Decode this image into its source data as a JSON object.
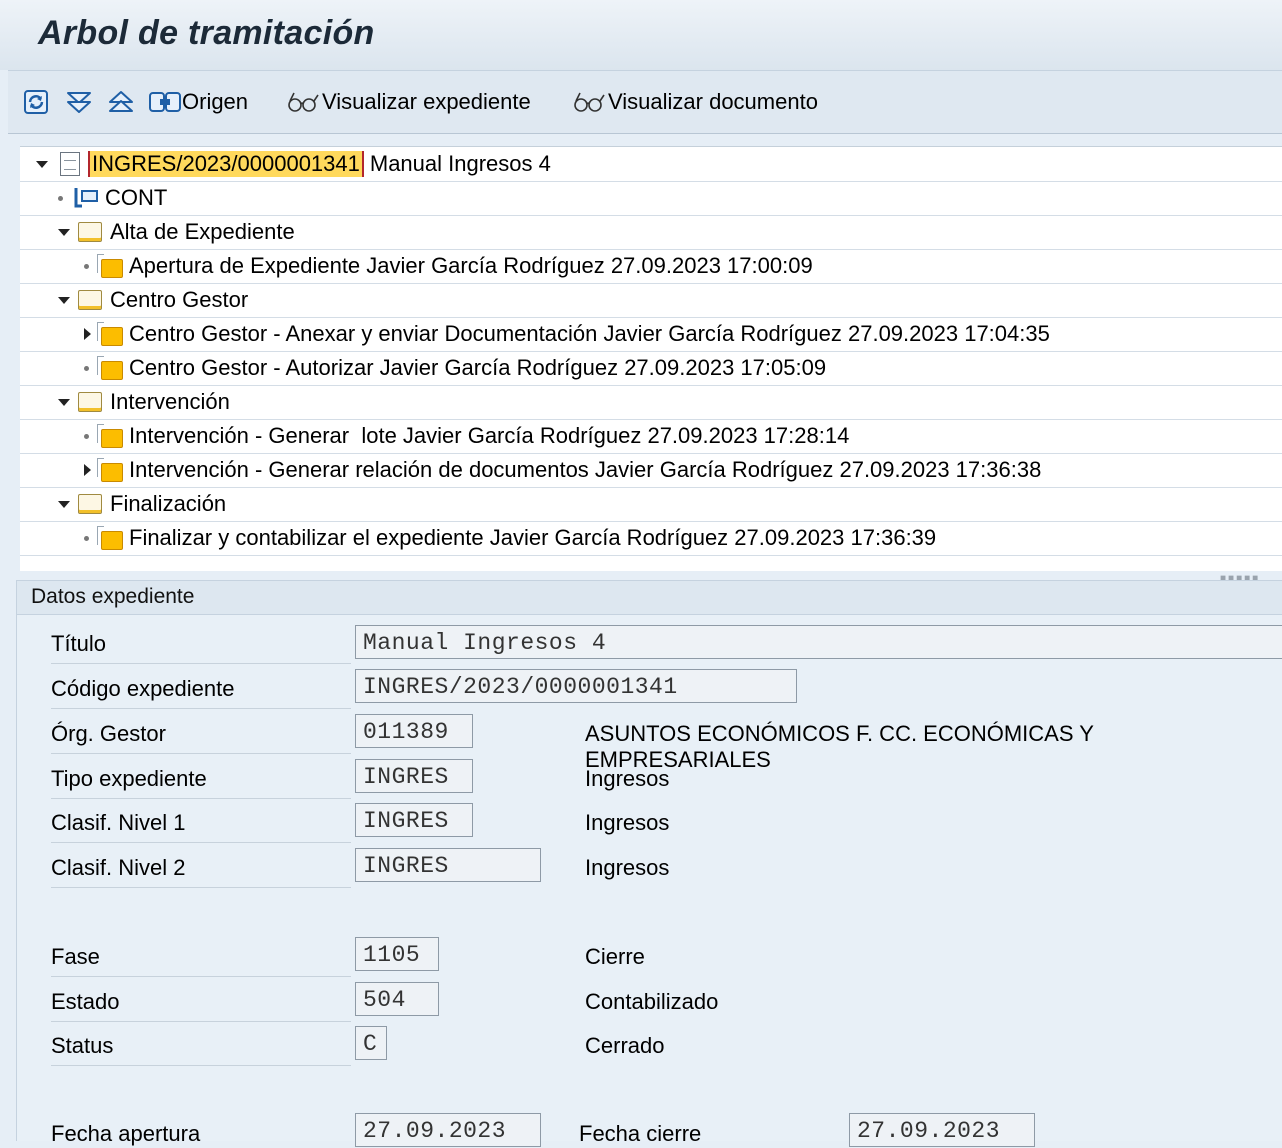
{
  "window": {
    "title": "Arbol de tramitación"
  },
  "toolbar": {
    "origin_label": "Origen",
    "view_file_label": "Visualizar expediente",
    "view_document_label": "Visualizar documento",
    "icons": [
      "refresh-icon",
      "expand-all-icon",
      "collapse-all-icon",
      "origin-icon",
      "glasses-icon",
      "glasses-icon"
    ]
  },
  "tree": {
    "root": {
      "id": "INGRES/2023/0000001341",
      "title": "Manual Ingresos 4"
    },
    "rows": [
      {
        "text": "CONT"
      },
      {
        "text": "Alta de Expediente"
      },
      {
        "text": "Apertura de Expediente Javier García Rodríguez 27.09.2023 17:00:09"
      },
      {
        "text": "Centro Gestor"
      },
      {
        "text": "Centro Gestor - Anexar y enviar Documentación Javier García Rodríguez 27.09.2023 17:04:35"
      },
      {
        "text": "Centro Gestor - Autorizar Javier García Rodríguez 27.09.2023 17:05:09"
      },
      {
        "text": "Intervención"
      },
      {
        "text": "Intervención - Generar  lote Javier García Rodríguez 27.09.2023 17:28:14"
      },
      {
        "text": "Intervención - Generar relación de documentos Javier García Rodríguez 27.09.2023 17:36:38"
      },
      {
        "text": "Finalización"
      },
      {
        "text": "Finalizar y contabilizar el expediente Javier García Rodríguez 27.09.2023 17:36:39"
      }
    ]
  },
  "details": {
    "header": "Datos expediente",
    "fields": [
      {
        "label": "Título",
        "value": "Manual Ingresos 4",
        "desc": ""
      },
      {
        "label": "Código expediente",
        "value": "INGRES/2023/0000001341",
        "desc": ""
      },
      {
        "label": "Órg. Gestor",
        "value": "011389",
        "desc": "ASUNTOS ECONÓMICOS F. CC. ECONÓMICAS Y EMPRESARIALES"
      },
      {
        "label": "Tipo expediente",
        "value": "INGRES",
        "desc": "Ingresos"
      },
      {
        "label": "Clasif. Nivel 1",
        "value": "INGRES",
        "desc": "Ingresos"
      },
      {
        "label": "Clasif. Nivel 2",
        "value": "INGRES",
        "desc": "Ingresos"
      },
      {
        "label": "Fase",
        "value": "1105",
        "desc": "Cierre"
      },
      {
        "label": "Estado",
        "value": "504",
        "desc": "Contabilizado"
      },
      {
        "label": "Status",
        "value": "C",
        "desc": "Cerrado"
      }
    ],
    "fecha_apertura_label": "Fecha apertura",
    "fecha_apertura_value": "27.09.2023",
    "fecha_cierre_label": "Fecha cierre",
    "fecha_cierre_value": "27.09.2023"
  }
}
